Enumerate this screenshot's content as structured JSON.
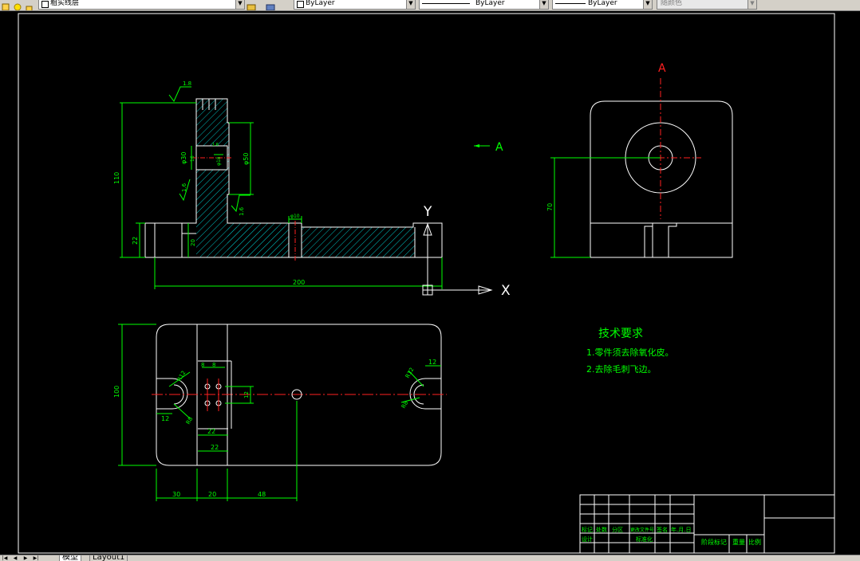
{
  "toolbar": {
    "layer_name": "粗实线层",
    "color_value": "ByLayer",
    "linetype_value": "ByLayer",
    "lineweight_value": "ByLayer",
    "plotstyle_value": "随颜色"
  },
  "drawing": {
    "section_arrow": "A",
    "view_label": "A",
    "ucs_x": "X",
    "ucs_y": "Y",
    "dims": {
      "height_110": "110",
      "height_22": "22",
      "base_200": "200",
      "dia_50": "φ50",
      "dia_30": "φ30",
      "dia_18": "φ18",
      "d16": "16",
      "d20": "20",
      "w10": "φ10",
      "rough_a": "1.6",
      "rough_b": "1.6",
      "rough_c": "1.6",
      "rough_top": "1.8",
      "side_70": "70",
      "plan_100": "100",
      "plan_30": "30",
      "plan_20": "20",
      "plan_48": "48",
      "plan_12a": "12",
      "plan_12b": "12",
      "plan_12c": "12",
      "plan_8a": "8",
      "plan_8b": "8",
      "plan_22a": "22",
      "plan_22b": "22",
      "plan_r12": "R12",
      "plan_r8": "R8",
      "plan_r12b": "R12",
      "plan_r8b": "R8"
    },
    "notes": {
      "title": "技术要求",
      "line1": "1.零件须去除氧化皮。",
      "line2": "2.去除毛刺飞边。"
    },
    "title_block": {
      "c1": "标记",
      "c2": "处数",
      "c3": "分区",
      "c4": "更改文件号",
      "c5": "签名",
      "c6": "年.月.日",
      "r2c1": "设计",
      "r2c4": "标准化",
      "stage": "阶段标记",
      "weight": "重量",
      "scale": "比例"
    }
  },
  "tabs": {
    "model": "模型",
    "layout1": "Layout1"
  }
}
